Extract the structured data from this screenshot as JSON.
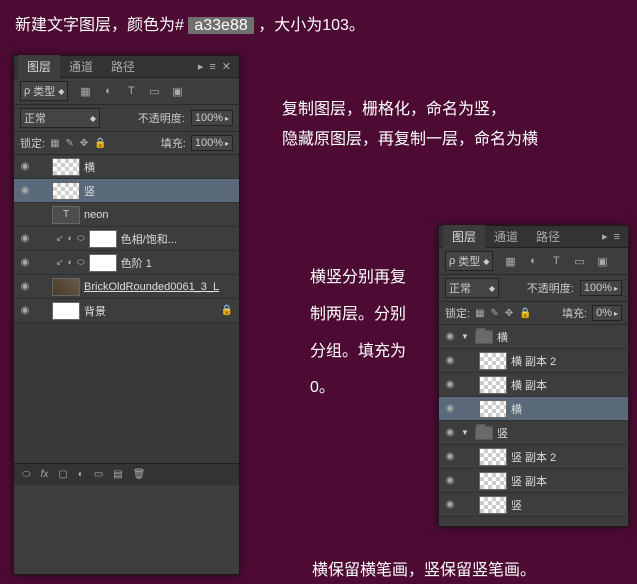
{
  "captions": {
    "top_prefix": "新建文字图层，颜色为#",
    "top_hex": "a33e88",
    "top_suffix": "，大小为103。",
    "right_upper": "复制图层，栅格化，命名为竖，\n隐藏原图层，再复制一层，命名为横",
    "middle": "横竖分别再复制两层。分别分组。填充为0。",
    "bottom": "横保留横笔画，竖保留竖笔画。"
  },
  "panel1": {
    "tabs": [
      "图层",
      "通道",
      "路径"
    ],
    "kind_label": "类型",
    "blend_mode": "正常",
    "opacity_label": "不透明度:",
    "opacity_value": "100%",
    "lock_label": "锁定:",
    "fill_label": "填充:",
    "fill_value": "100%",
    "layers": [
      {
        "eye": true,
        "name": "横",
        "type": "raster"
      },
      {
        "eye": true,
        "name": "竖",
        "type": "raster",
        "selected": true
      },
      {
        "eye": false,
        "name": "neon",
        "type": "text"
      },
      {
        "eye": true,
        "name": "色相/饱和...",
        "type": "adj"
      },
      {
        "eye": true,
        "name": "色阶 1",
        "type": "adj"
      },
      {
        "eye": true,
        "name": "BrickOldRounded0061_3_L",
        "type": "smart",
        "underline": true
      },
      {
        "eye": true,
        "name": "背景",
        "type": "bg",
        "locked": true
      }
    ]
  },
  "panel2": {
    "tabs": [
      "图层",
      "通道",
      "路径"
    ],
    "kind_label": "类型",
    "blend_mode": "正常",
    "opacity_label": "不透明度:",
    "opacity_value": "100%",
    "lock_label": "锁定:",
    "fill_label": "填充:",
    "fill_value": "0%",
    "groups": [
      {
        "name": "横",
        "layers": [
          "横 副本 2",
          "横 副本",
          "横"
        ],
        "selected_layer_idx": 2
      },
      {
        "name": "竖",
        "layers": [
          "竖 副本 2",
          "竖 副本",
          "竖"
        ]
      }
    ]
  },
  "icons": {
    "menu": "≡",
    "close": "▸",
    "kind_image": "▦",
    "kind_adj": "◐",
    "kind_text": "T",
    "kind_shape": "▭",
    "kind_smart": "▣",
    "eye": "◉",
    "lock_all": "▦",
    "lock_paint": "✎",
    "lock_move": "✥",
    "lock_lock": "🔒",
    "fx": "fx",
    "mask": "▢",
    "adj": "◐",
    "group": "▭",
    "new": "▤",
    "trash": "🗑",
    "link": "⬭"
  }
}
